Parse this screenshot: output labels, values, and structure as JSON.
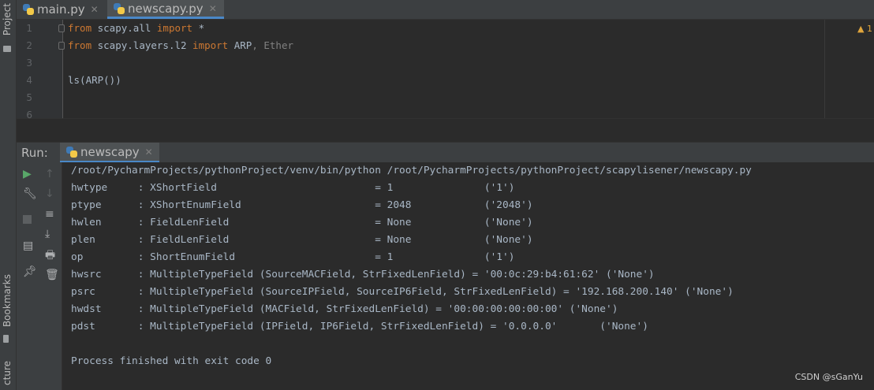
{
  "left_strip": {
    "project_label": "Project",
    "bookmarks_label": "Bookmarks",
    "structure_label": "cture"
  },
  "tabs": [
    {
      "label": "main.py",
      "active": false
    },
    {
      "label": "newscapy.py",
      "active": true
    }
  ],
  "editor": {
    "line_numbers": [
      "1",
      "2",
      "3",
      "4",
      "5",
      "6"
    ],
    "lines": [
      {
        "kw1": "from",
        "mid": " scapy.all ",
        "kw2": "import",
        "rest": " *",
        "dim": ""
      },
      {
        "kw1": "from",
        "mid": " scapy.layers.l2 ",
        "kw2": "import",
        "rest": " ARP",
        "dim": ", Ether"
      },
      {
        "kw1": "",
        "mid": "",
        "kw2": "",
        "rest": "",
        "dim": ""
      },
      {
        "kw1": "",
        "mid": "ls(ARP())",
        "kw2": "",
        "rest": "",
        "dim": ""
      },
      {
        "kw1": "",
        "mid": "",
        "kw2": "",
        "rest": "",
        "dim": ""
      },
      {
        "kw1": "",
        "mid": "",
        "kw2": "",
        "rest": "",
        "dim": ""
      }
    ],
    "warning_badge": "▲ 1"
  },
  "run": {
    "title": "Run:",
    "tab_label": "newscapy",
    "output": [
      "/root/PycharmProjects/pythonProject/venv/bin/python /root/PycharmProjects/pythonProject/scapylisener/newscapy.py",
      "hwtype     : XShortField                          = 1               ('1')",
      "ptype      : XShortEnumField                      = 2048            ('2048')",
      "hwlen      : FieldLenField                        = None            ('None')",
      "plen       : FieldLenField                        = None            ('None')",
      "op         : ShortEnumField                       = 1               ('1')",
      "hwsrc      : MultipleTypeField (SourceMACField, StrFixedLenField) = '00:0c:29:b4:61:62' ('None')",
      "psrc       : MultipleTypeField (SourceIPField, SourceIP6Field, StrFixedLenField) = '192.168.200.140' ('None')",
      "hwdst      : MultipleTypeField (MACField, StrFixedLenField) = '00:00:00:00:00:00' ('None')",
      "pdst       : MultipleTypeField (IPField, IP6Field, StrFixedLenField) = '0.0.0.0'       ('None')",
      "",
      "Process finished with exit code 0"
    ]
  },
  "watermark": "CSDN @sGanYu",
  "colors": {
    "keyword": "#cc7832",
    "text": "#a9b7c6",
    "background": "#2b2b2b",
    "panel": "#3c3f41",
    "accent": "#4a88c7",
    "run_green": "#59a869"
  }
}
